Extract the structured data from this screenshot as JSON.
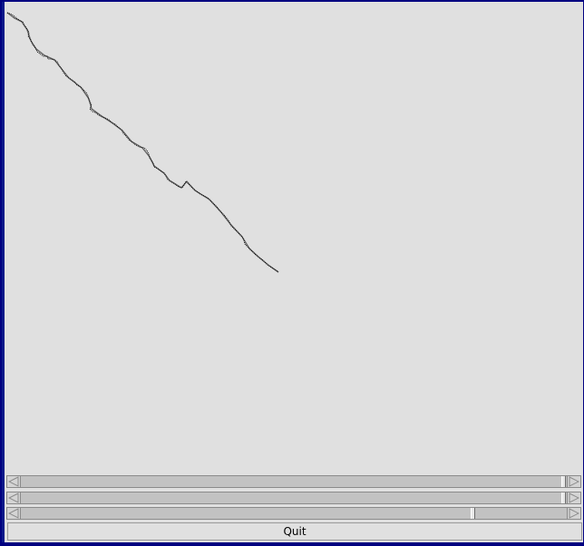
{
  "canvas": {
    "trace_color": "#000000",
    "background": "#e0e0e0"
  },
  "scrollbars": [
    {
      "name": "scrollbar-1",
      "value_fraction": 1.0
    },
    {
      "name": "scrollbar-2",
      "value_fraction": 1.0
    },
    {
      "name": "scrollbar-3",
      "value_fraction": 0.83
    }
  ],
  "icons": {
    "left": "arrow-left-icon",
    "right": "arrow-right-icon"
  },
  "buttons": {
    "quit_label": "Quit"
  },
  "colors": {
    "window_border": "#0a1a8a",
    "scrollbar_trough": "#c2c2c2"
  }
}
